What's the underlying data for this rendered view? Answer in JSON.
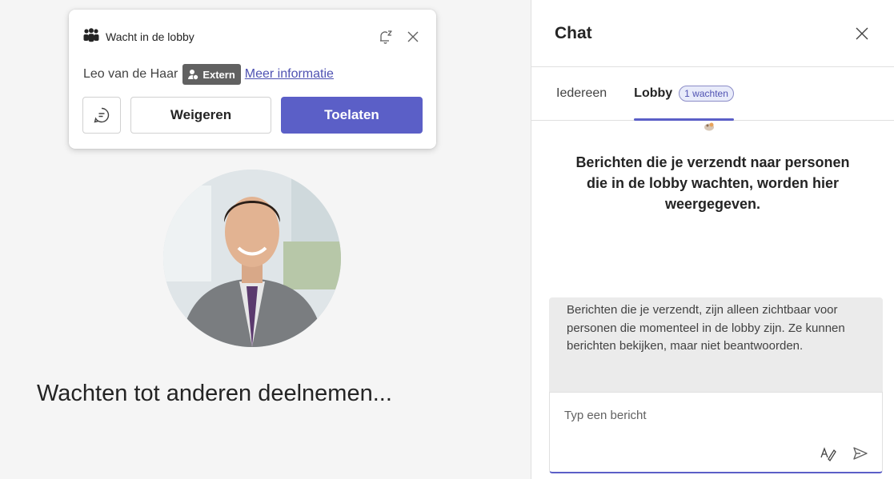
{
  "toast": {
    "title": "Wacht in de lobby",
    "name": "Leo van de Haar",
    "badge": "Extern",
    "link": "Meer informatie",
    "decline": "Weigeren",
    "admit": "Toelaten"
  },
  "stage": {
    "waiting": "Wachten tot anderen deelnemen..."
  },
  "chat": {
    "title": "Chat",
    "tabs": [
      {
        "label": "Iedereen"
      },
      {
        "label": "Lobby",
        "badge": "1 wachten"
      }
    ],
    "hint": "Berichten die je verzendt naar personen die in de lobby wachten, worden hier weergegeven.",
    "notice": "Berichten die je verzendt, zijn alleen zichtbaar voor personen die momenteel in de lobby zijn. Ze kunnen berichten bekijken, maar niet beantwoorden.",
    "placeholder": "Typ een bericht"
  },
  "colors": {
    "accent": "#5b5fc7",
    "link": "#4f52b2",
    "badge": "#616161"
  }
}
